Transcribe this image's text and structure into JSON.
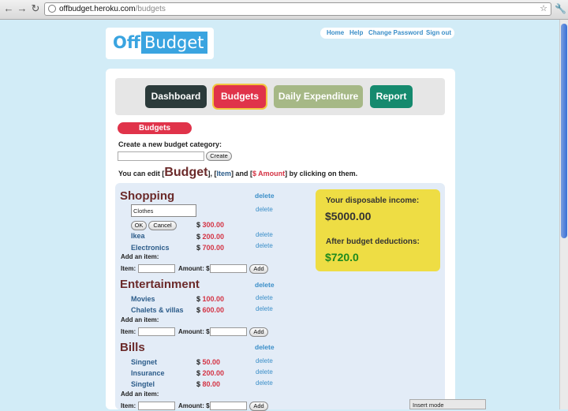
{
  "browser": {
    "url_host": "offbudget.heroku.com",
    "url_path": "/budgets"
  },
  "logo": {
    "part1": "Off",
    "part2": "Budget"
  },
  "toplinks": [
    "Home",
    "Help",
    "Change Password",
    "Sign out"
  ],
  "tabs": {
    "dashboard": "Dashboard",
    "budgets": "Budgets",
    "daily": "Daily Expenditure",
    "report": "Report"
  },
  "colors": {
    "dashboard": "#2b3a3a",
    "budgets": "#e0334a",
    "daily": "#a6b886",
    "report": "#158a6e",
    "accent": "#3aa4e0"
  },
  "page": {
    "heading": "Budgets",
    "create_label": "Create a new budget category:",
    "create_button": "Create",
    "edit_prefix": "You can edit [",
    "edit_budget": "Budget",
    "edit_mid1": "], [",
    "edit_item": "Item",
    "edit_mid2": "] and [",
    "edit_amount": "$ Amount",
    "edit_suffix": "] by clicking on them."
  },
  "common": {
    "delete": "delete",
    "add_item": "Add an item:",
    "item_label": "Item:",
    "amount_label": "Amount: $",
    "add_button": "Add",
    "ok_button": "OK",
    "cancel_button": "Cancel",
    "currency": "$"
  },
  "categories": [
    {
      "name": "Shopping",
      "editing_value": "Clothes",
      "editing_amount": "300.00",
      "items": [
        {
          "name": "Ikea",
          "amount": "200.00"
        },
        {
          "name": "Electronics",
          "amount": "700.00"
        }
      ]
    },
    {
      "name": "Entertainment",
      "items": [
        {
          "name": "Movies",
          "amount": "100.00"
        },
        {
          "name": "Chalets & villas",
          "amount": "600.00"
        }
      ]
    },
    {
      "name": "Bills",
      "items": [
        {
          "name": "Singnet",
          "amount": "50.00"
        },
        {
          "name": "Insurance",
          "amount": "200.00"
        },
        {
          "name": "Singtel",
          "amount": "80.00"
        }
      ]
    }
  ],
  "income": {
    "disposable_label": "Your disposable income:",
    "disposable_value": "$5000.00",
    "after_label": "After budget deductions:",
    "after_value": "$720.0"
  },
  "status": {
    "insert_mode": "Insert mode"
  }
}
